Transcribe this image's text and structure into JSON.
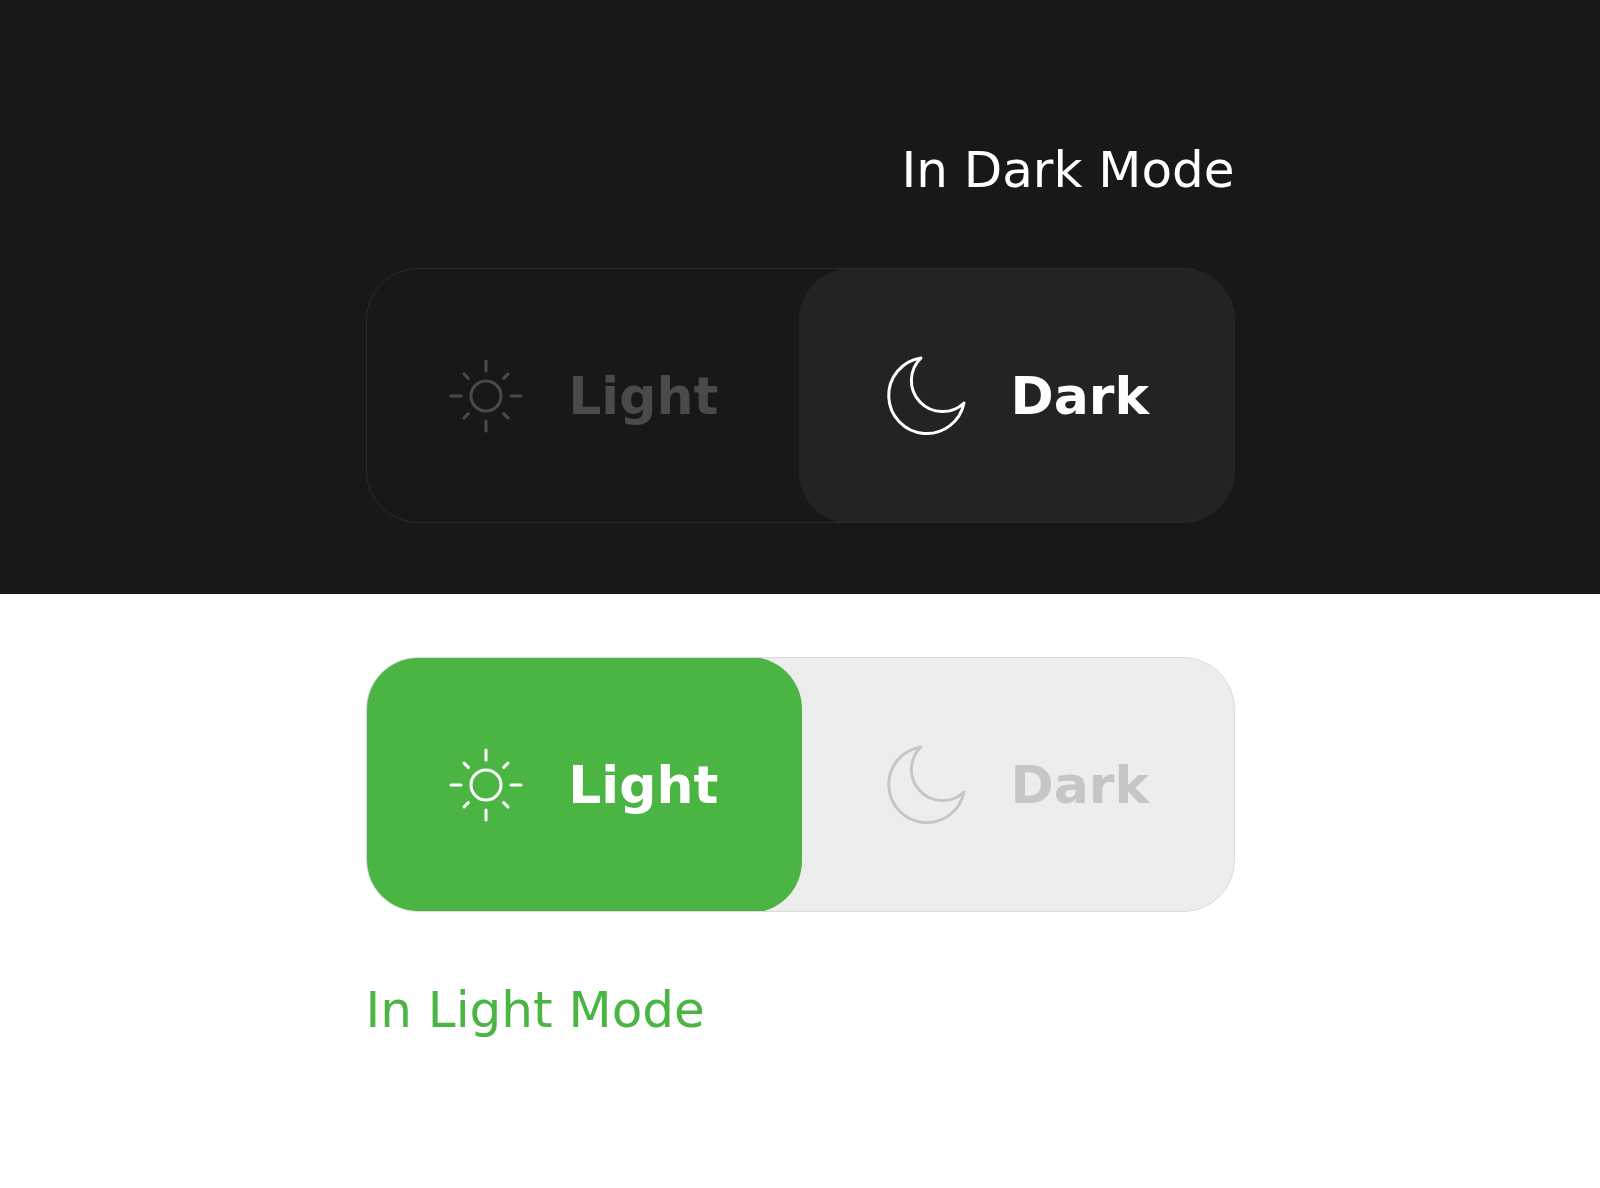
{
  "sections": [
    {
      "kind": "dark",
      "title": "In Dark Mode",
      "options": [
        {
          "label": "Light",
          "kind": "sun",
          "selected": false
        },
        {
          "label": "Dark",
          "kind": "moon",
          "selected": true
        }
      ]
    },
    {
      "kind": "light",
      "title": "In Light Mode",
      "options": [
        {
          "label": "Light",
          "kind": "sun",
          "selected": true
        },
        {
          "label": "Dark",
          "kind": "moon",
          "selected": false
        }
      ]
    }
  ]
}
